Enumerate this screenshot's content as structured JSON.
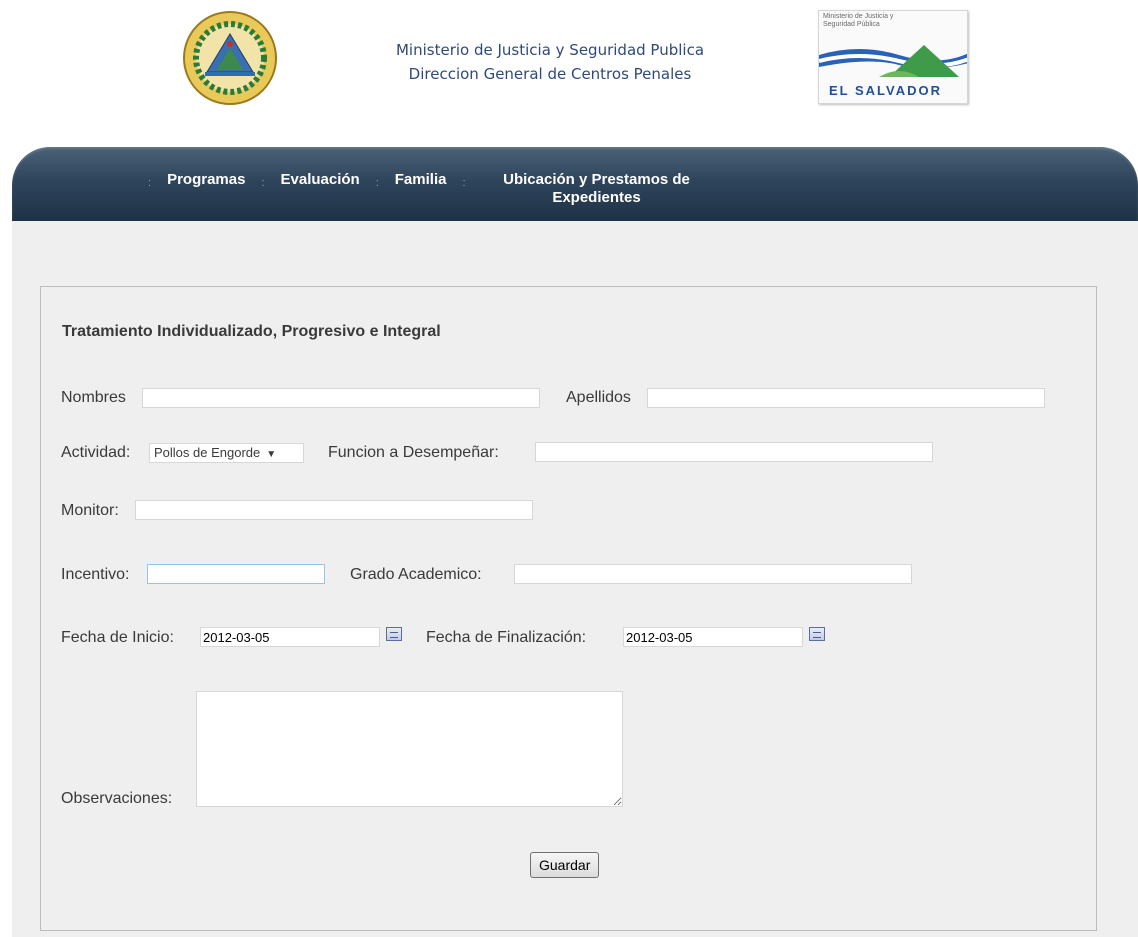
{
  "header": {
    "title_line1": "Ministerio de Justicia y Seguridad Publica",
    "title_line2": "Direccion General de Centros Penales",
    "logo_caption": "Ministerio de Justicia y Seguridad Pública",
    "logo_country": "EL SALVADOR"
  },
  "nav": {
    "items": [
      {
        "label": "Programas"
      },
      {
        "label": "Evaluación"
      },
      {
        "label": "Familia"
      },
      {
        "label": "Ubicación y Prestamos de Expedientes"
      }
    ],
    "separator": ":"
  },
  "form": {
    "title": "Tratamiento Individualizado, Progresivo e Integral",
    "nombres_label": "Nombres",
    "nombres_value": "",
    "apellidos_label": "Apellidos",
    "apellidos_value": "",
    "actividad_label": "Actividad:",
    "actividad_selected": "Pollos de Engorde",
    "funcion_label": "Funcion a Desempeñar:",
    "funcion_value": "",
    "monitor_label": "Monitor:",
    "monitor_value": "",
    "incentivo_label": "Incentivo:",
    "incentivo_value": "",
    "grado_label": "Grado Academico:",
    "grado_value": "",
    "fecha_inicio_label": "Fecha de Inicio:",
    "fecha_inicio_value": "2012-03-05",
    "fecha_fin_label": "Fecha de Finalización:",
    "fecha_fin_value": "2012-03-05",
    "observaciones_label": "Observaciones:",
    "observaciones_value": "",
    "submit_label": "Guardar"
  },
  "colors": {
    "nav_bg": "#2f455b",
    "header_title": "#2f4a7a",
    "content_bg": "#efefef"
  }
}
